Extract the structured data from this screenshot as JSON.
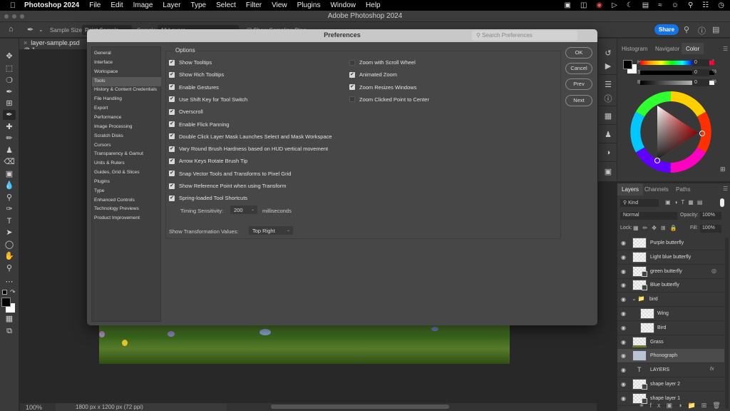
{
  "menubar": {
    "apple_icon": "",
    "app_name": "Photoshop 2024",
    "items": [
      "File",
      "Edit",
      "Image",
      "Layer",
      "Type",
      "Select",
      "Filter",
      "View",
      "Plugins",
      "Window",
      "Help"
    ],
    "tray_icons": [
      "screen-record-icon",
      "screen-mirror-icon",
      "cast-icon",
      "play-icon",
      "moon-icon",
      "display-icon",
      "wifi-icon",
      "user-icon",
      "search-icon",
      "control-center-icon",
      "clock-icon"
    ]
  },
  "window": {
    "title": "Adobe Photoshop 2024"
  },
  "optionsbar": {
    "sample_size_label": "Sample Size:",
    "sample_size_value": "Point Sample",
    "sample_label": "Sample:",
    "sample_value": "All Layers",
    "show_ring_label": "Show Sampling Ring",
    "share_label": "Share"
  },
  "document": {
    "tab_label": "layer-sample.psd @ 1",
    "zoom": "100%",
    "dimensions": "1800 px x 1200 px (72 ppi)"
  },
  "preferences": {
    "title": "Preferences",
    "search_placeholder": "Search Preferences",
    "categories": [
      {
        "label": "General",
        "selected": false
      },
      {
        "label": "Interface",
        "selected": false
      },
      {
        "label": "Workspace",
        "selected": false
      },
      {
        "label": "Tools",
        "selected": true
      },
      {
        "label": "History & Content Credentials",
        "selected": false
      },
      {
        "label": "File Handling",
        "selected": false
      },
      {
        "label": "Export",
        "selected": false
      },
      {
        "label": "Performance",
        "selected": false
      },
      {
        "label": "Image Processing",
        "selected": false
      },
      {
        "label": "Scratch Disks",
        "selected": false
      },
      {
        "label": "Cursors",
        "selected": false
      },
      {
        "label": "Transparency & Gamut",
        "selected": false
      },
      {
        "label": "Units & Rulers",
        "selected": false
      },
      {
        "label": "Guides, Grid & Slices",
        "selected": false
      },
      {
        "label": "Plugins",
        "selected": false
      },
      {
        "label": "Type",
        "selected": false
      },
      {
        "label": "Enhanced Controls",
        "selected": false
      },
      {
        "label": "Technology Previews",
        "selected": false
      },
      {
        "label": "Product Improvement",
        "selected": false
      }
    ],
    "options_group_label": "Options",
    "left_options": [
      {
        "label": "Show Tooltips",
        "checked": true
      },
      {
        "label": "Show Rich Tooltips",
        "checked": true
      },
      {
        "label": "Enable Gestures",
        "checked": true
      },
      {
        "label": "Use Shift Key for Tool Switch",
        "checked": true
      },
      {
        "label": "Overscroll",
        "checked": true
      },
      {
        "label": "Enable Flick Panning",
        "checked": true
      },
      {
        "label": "Double Click Layer Mask Launches Select and Mask Workspace",
        "checked": true
      },
      {
        "label": "Vary Round Brush Hardness based on HUD vertical movement",
        "checked": true
      },
      {
        "label": "Arrow Keys Rotate Brush Tip",
        "checked": true
      },
      {
        "label": "Snap Vector Tools and Transforms to Pixel Grid",
        "checked": true
      },
      {
        "label": "Show Reference Point when using Transform",
        "checked": true
      },
      {
        "label": "Spring-loaded Tool Shortcuts",
        "checked": true
      }
    ],
    "right_options": [
      {
        "label": "Zoom with Scroll Wheel",
        "checked": false
      },
      {
        "label": "Animated Zoom",
        "checked": true
      },
      {
        "label": "Zoom Resizes Windows",
        "checked": true
      },
      {
        "label": "Zoom Clicked Point to Center",
        "checked": false
      }
    ],
    "timing_label": "Timing Sensitivity:",
    "timing_value": "200",
    "timing_unit": "milliseconds",
    "transform_values_label": "Show Transformation Values:",
    "transform_values_value": "Top Right",
    "buttons": {
      "ok": "OK",
      "cancel": "Cancel",
      "prev": "Prev",
      "next": "Next"
    }
  },
  "color_panel": {
    "tabs": [
      "Histogram",
      "Navigator",
      "Color"
    ],
    "active_tab": "Color",
    "h_label": "H",
    "h_value": "0",
    "h_unit": "°",
    "s_label": "S",
    "s_value": "0",
    "s_unit": "%",
    "b_label": "B",
    "b_value": "0",
    "b_unit": "%",
    "foreground": "#000000",
    "background": "#ffffff"
  },
  "layers_panel": {
    "tabs": [
      "Layers",
      "Channels",
      "Paths"
    ],
    "active_tab": "Layers",
    "filter_label": "Kind",
    "blend_mode": "Normal",
    "opacity_label": "Opacity:",
    "opacity_value": "100%",
    "lock_label": "Lock:",
    "fill_label": "Fill:",
    "fill_value": "100%",
    "layers": [
      {
        "name": "Purple butterfly",
        "type": "pixel",
        "indent": false,
        "selected": false
      },
      {
        "name": "Light blue butterfly",
        "type": "pixel",
        "indent": false,
        "selected": false
      },
      {
        "name": "green butterfly",
        "type": "smart",
        "indent": false,
        "selected": false
      },
      {
        "name": "Blue butterfly",
        "type": "smart",
        "indent": false,
        "selected": false
      },
      {
        "name": "bird",
        "type": "group",
        "indent": false,
        "selected": false
      },
      {
        "name": "Wing",
        "type": "pixel",
        "indent": true,
        "selected": false
      },
      {
        "name": "Bird",
        "type": "pixel",
        "indent": true,
        "selected": false
      },
      {
        "name": "Grass",
        "type": "pixel",
        "indent": false,
        "selected": false
      },
      {
        "name": "Phonograph",
        "type": "pixel",
        "indent": false,
        "selected": true
      },
      {
        "name": "LAYERS",
        "type": "text",
        "indent": false,
        "selected": false
      },
      {
        "name": "shape layer 2",
        "type": "shape",
        "indent": false,
        "selected": false
      },
      {
        "name": "shape layer 1",
        "type": "shape",
        "indent": false,
        "selected": false
      }
    ]
  }
}
